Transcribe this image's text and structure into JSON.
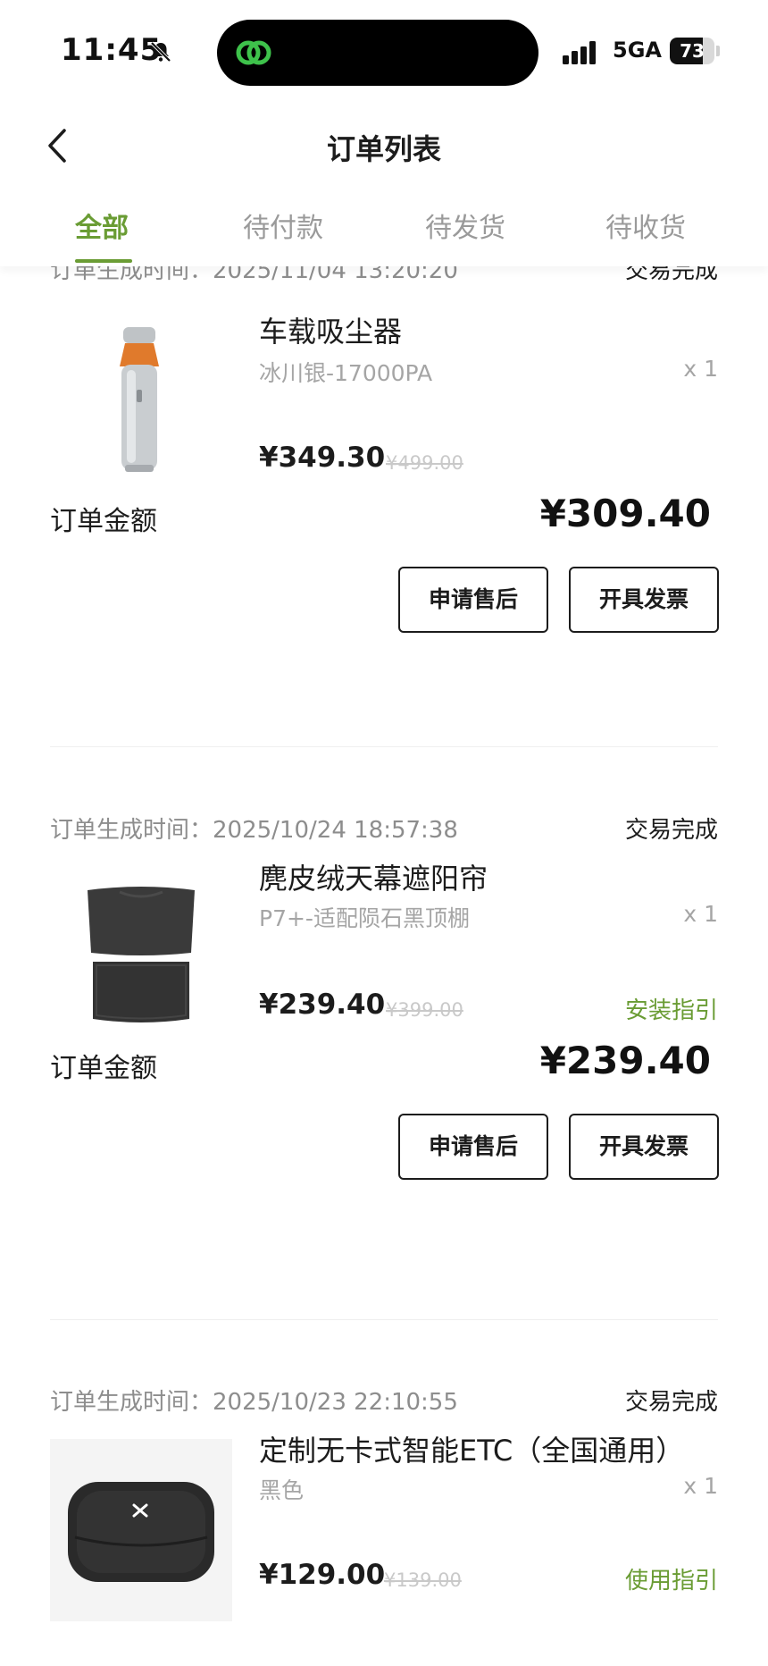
{
  "status_bar": {
    "time": "11:45",
    "network": "5GA",
    "battery": 73,
    "battery_text": "73",
    "accent": "#3ec24b"
  },
  "header": {
    "title": "订单列表"
  },
  "tabs": [
    {
      "label": "全部",
      "active": true
    },
    {
      "label": "待付款",
      "active": false
    },
    {
      "label": "待发货",
      "active": false
    },
    {
      "label": "待收货",
      "active": false
    }
  ],
  "colors": {
    "accent": "#6a9c34",
    "text": "#1c1c1c",
    "muted": "#8d8d8d"
  },
  "orders": [
    {
      "time_label": "订单生成时间：2025/11/04 13:20:20",
      "status": "交易完成",
      "product_name": "车载吸尘器",
      "spec": "冰川银-17000PA",
      "qty": "x 1",
      "price": "¥349.30",
      "original_price": "¥499.00",
      "total_label": "订单金额",
      "total": "¥309.40",
      "buttons": [
        "申请售后",
        "开具发票"
      ]
    },
    {
      "time_label": "订单生成时间：2025/10/24 18:57:38",
      "status": "交易完成",
      "product_name": "麂皮绒天幕遮阳帘",
      "spec": "P7+-适配陨石黑顶棚",
      "qty": "x 1",
      "price": "¥239.40",
      "original_price": "¥399.00",
      "guide": "安装指引",
      "total_label": "订单金额",
      "total": "¥239.40",
      "buttons": [
        "申请售后",
        "开具发票"
      ]
    },
    {
      "time_label": "订单生成时间：2025/10/23 22:10:55",
      "status": "交易完成",
      "product_name": "定制无卡式智能ETC（全国通用）",
      "spec": "黑色",
      "qty": "x 1",
      "price": "¥129.00",
      "original_price": "¥139.00",
      "guide": "使用指引"
    }
  ]
}
